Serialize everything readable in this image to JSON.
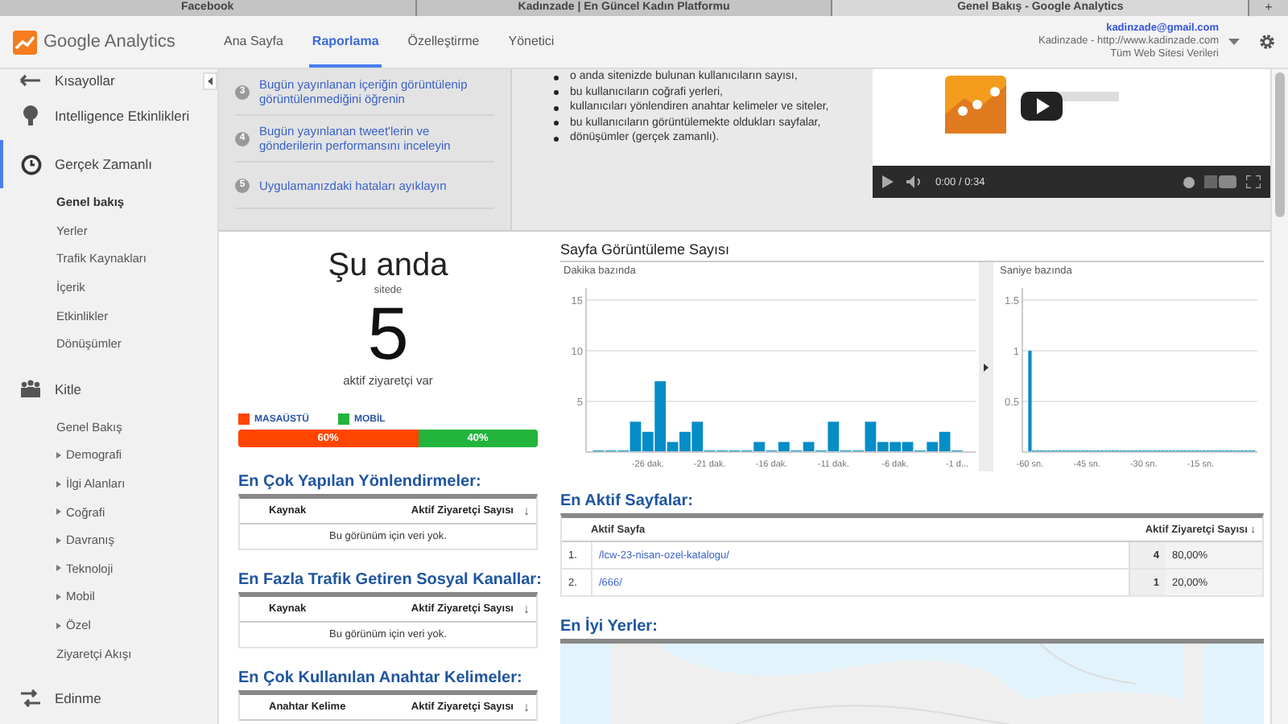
{
  "browser_tabs": [
    {
      "title": "Facebook",
      "selected": false
    },
    {
      "title": "Kadınzade | En Güncel Kadın Platformu",
      "selected": false
    },
    {
      "title": "Genel Bakış - Google Analytics",
      "selected": true
    }
  ],
  "new_tab": "+",
  "logo_text": "Google Analytics",
  "nav": [
    {
      "label": "Ana Sayfa",
      "selected": false
    },
    {
      "label": "Raporlama",
      "selected": true
    },
    {
      "label": "Özelleştirme",
      "selected": false
    },
    {
      "label": "Yönetici",
      "selected": false
    }
  ],
  "account": {
    "email": "kadinzade@gmail.com",
    "property": "Kadinzade - http://www.kadinzade.com",
    "view": "Tüm Web Sitesi Verileri"
  },
  "sidebar": {
    "items": [
      {
        "label": "Kısayollar",
        "selected": false
      },
      {
        "label": "Intelligence Etkinlikleri",
        "selected": false
      },
      {
        "label": "Gerçek Zamanlı",
        "selected": true,
        "children": [
          {
            "label": "Genel bakış",
            "selected": true,
            "expandable": false
          },
          {
            "label": "Yerler",
            "selected": false,
            "expandable": false
          },
          {
            "label": "Trafik Kaynakları",
            "selected": false,
            "expandable": false
          },
          {
            "label": "İçerik",
            "selected": false,
            "expandable": false
          },
          {
            "label": "Etkinlikler",
            "selected": false,
            "expandable": false
          },
          {
            "label": "Dönüşümler",
            "selected": false,
            "expandable": false
          }
        ]
      },
      {
        "label": "Kitle",
        "selected": false,
        "children": [
          {
            "label": "Genel Bakış",
            "selected": false,
            "expandable": false
          },
          {
            "label": "Demografi",
            "selected": false,
            "expandable": true
          },
          {
            "label": "İlgi Alanları",
            "selected": false,
            "expandable": true
          },
          {
            "label": "Coğrafi",
            "selected": false,
            "expandable": true
          },
          {
            "label": "Davranış",
            "selected": false,
            "expandable": true
          },
          {
            "label": "Teknoloji",
            "selected": false,
            "expandable": true
          },
          {
            "label": "Mobil",
            "selected": false,
            "expandable": true
          },
          {
            "label": "Özel",
            "selected": false,
            "expandable": true
          },
          {
            "label": "Ziyaretçi Akışı",
            "selected": false,
            "expandable": false
          }
        ]
      },
      {
        "label": "Edinme",
        "selected": false
      }
    ]
  },
  "intro": {
    "steps": [
      {
        "number": "3",
        "text": "Bugün yayınlanan içeriğin görüntülenip görüntülenmediğini öğrenin"
      },
      {
        "number": "4",
        "text": "Bugün yayınlanan tweet'lerin ve gönderilerin performansını inceleyin"
      },
      {
        "number": "5",
        "text": "Uygulamanızdaki hataları ayıklayın"
      }
    ],
    "bullets": [
      "o anda sitenizde bulunan kullanıcıların sayısı,",
      "bu kullanıcıların coğrafi yerleri,",
      "kullanıcıları yönlendiren anahtar kelimeler ve siteler,",
      "bu kullanıcıların görüntülemekte oldukları sayfalar,",
      "dönüşümler (gerçek zamanlı)."
    ],
    "video": {
      "kind": "picture",
      "time": "0:00 / 0:34"
    }
  },
  "now": {
    "title": "Şu anda",
    "subtitle": "sitede",
    "count": "5",
    "caption": "aktif ziyaretçi var",
    "devices": [
      {
        "label": "MASAÜSTÜ",
        "color": "#ff4500",
        "level": 0.6,
        "reading": "60%"
      },
      {
        "label": "MOBİL",
        "color": "#22b43c",
        "level": 0.4,
        "reading": "40%"
      }
    ]
  },
  "left_tables": [
    {
      "title": "En Çok Yapılan Yönlendirmeler:",
      "columns": [
        "Kaynak",
        "Aktif Ziyaretçi Sayısı"
      ],
      "sort_mark": "↓",
      "empty": "Bu görünüm için veri yok."
    },
    {
      "title": "En Fazla Trafik Getiren Sosyal Kanallar:",
      "columns": [
        "Kaynak",
        "Aktif Ziyaretçi Sayısı"
      ],
      "sort_mark": "↓",
      "empty": "Bu görünüm için veri yok."
    },
    {
      "title": "En Çok Kullanılan Anahtar Kelimeler:",
      "columns": [
        "Anahtar Kelime",
        "Aktif Ziyaretçi Sayısı"
      ],
      "sort_mark": "↓"
    }
  ],
  "pageviews": {
    "title": "Sayfa Görüntüleme Sayısı",
    "panels": [
      {
        "label": "Dakika bazında",
        "chart_data": {
          "type": "bar",
          "x": [
            -30,
            -29,
            -28,
            -27,
            -26,
            -25,
            -24,
            -23,
            -22,
            -21,
            -20,
            -19,
            -18,
            -17,
            -16,
            -15,
            -14,
            -13,
            -12,
            -11,
            -10,
            -9,
            -8,
            -7,
            -6,
            -5,
            -4,
            -3,
            -2,
            -1
          ],
          "series": [
            {
              "color": "#058dc7",
              "values": [
                0,
                0,
                0,
                3,
                2,
                7,
                1,
                2,
                3,
                0,
                0,
                0,
                0,
                1,
                0,
                1,
                0,
                1,
                0,
                3,
                0,
                0,
                3,
                1,
                1,
                1,
                0,
                1,
                2,
                0
              ]
            }
          ],
          "xlim": [
            -31,
            0.5
          ],
          "ylim": [
            0,
            16.2
          ],
          "grid": true,
          "yticks": [
            {
              "value": 5,
              "label": "5"
            },
            {
              "value": 10,
              "label": "10"
            },
            {
              "value": 15,
              "label": "15"
            }
          ],
          "xticks": [
            {
              "value": -26,
              "label": "-26 dak."
            },
            {
              "value": -21,
              "label": "-21 dak."
            },
            {
              "value": -16,
              "label": "-16 dak."
            },
            {
              "value": -11,
              "label": "-11 dak."
            },
            {
              "value": -6,
              "label": "-6 dak."
            },
            {
              "value": -1,
              "label": "-1 d..."
            }
          ]
        }
      },
      {
        "label": "Saniye bazında",
        "chart_data": {
          "type": "bar",
          "x": [
            -60,
            -59,
            -58,
            -57,
            -56,
            -55,
            -54,
            -53,
            -52,
            -51,
            -50,
            -49,
            -48,
            -47,
            -46,
            -45,
            -44,
            -43,
            -42,
            -41,
            -40,
            -39,
            -38,
            -37,
            -36,
            -35,
            -34,
            -33,
            -32,
            -31,
            -30,
            -29,
            -28,
            -27,
            -26,
            -25,
            -24,
            -23,
            -22,
            -21,
            -20,
            -19,
            -18,
            -17,
            -16,
            -15,
            -14,
            -13,
            -12,
            -11,
            -10,
            -9,
            -8,
            -7,
            -6,
            -5,
            -4,
            -3,
            -2,
            -1
          ],
          "series": [
            {
              "color": "#058dc7",
              "values": [
                1,
                0,
                0,
                0,
                0,
                0,
                0,
                0,
                0,
                0,
                0,
                0,
                0,
                0,
                0,
                0,
                0,
                0,
                0,
                0,
                0,
                0,
                0,
                0,
                0,
                0,
                0,
                0,
                0,
                0,
                0,
                0,
                0,
                0,
                0,
                0,
                0,
                0,
                0,
                0,
                0,
                0,
                0,
                0,
                0,
                0,
                0,
                0,
                0,
                0,
                0,
                0,
                0,
                0,
                0,
                0,
                0,
                0,
                0,
                0
              ]
            }
          ],
          "xlim": [
            -62,
            0
          ],
          "ylim": [
            0,
            1.62
          ],
          "grid": true,
          "yticks": [
            {
              "value": 0.5,
              "label": "0.5"
            },
            {
              "value": 1,
              "label": "1"
            },
            {
              "value": 1.5,
              "label": "1.5"
            }
          ],
          "xticks": [
            {
              "value": -60,
              "label": "-60 sn."
            },
            {
              "value": -45,
              "label": "-45 sn."
            },
            {
              "value": -30,
              "label": "-30 sn."
            },
            {
              "value": -15,
              "label": "-15 sn."
            }
          ]
        }
      }
    ]
  },
  "active_pages": {
    "title": "En Aktif Sayfalar:",
    "columns": [
      "Aktif Sayfa",
      "Aktif Ziyaretçi Sayısı"
    ],
    "sort_mark": "↓",
    "rows": [
      {
        "rank": "1.",
        "page": "/lcw-23-nisan-ozel-katalogu/",
        "count": "4",
        "share": "80,00%"
      },
      {
        "rank": "2.",
        "page": "/666/",
        "count": "1",
        "share": "20,00%"
      }
    ]
  },
  "top_places": {
    "title": "En İyi Yerler:"
  }
}
